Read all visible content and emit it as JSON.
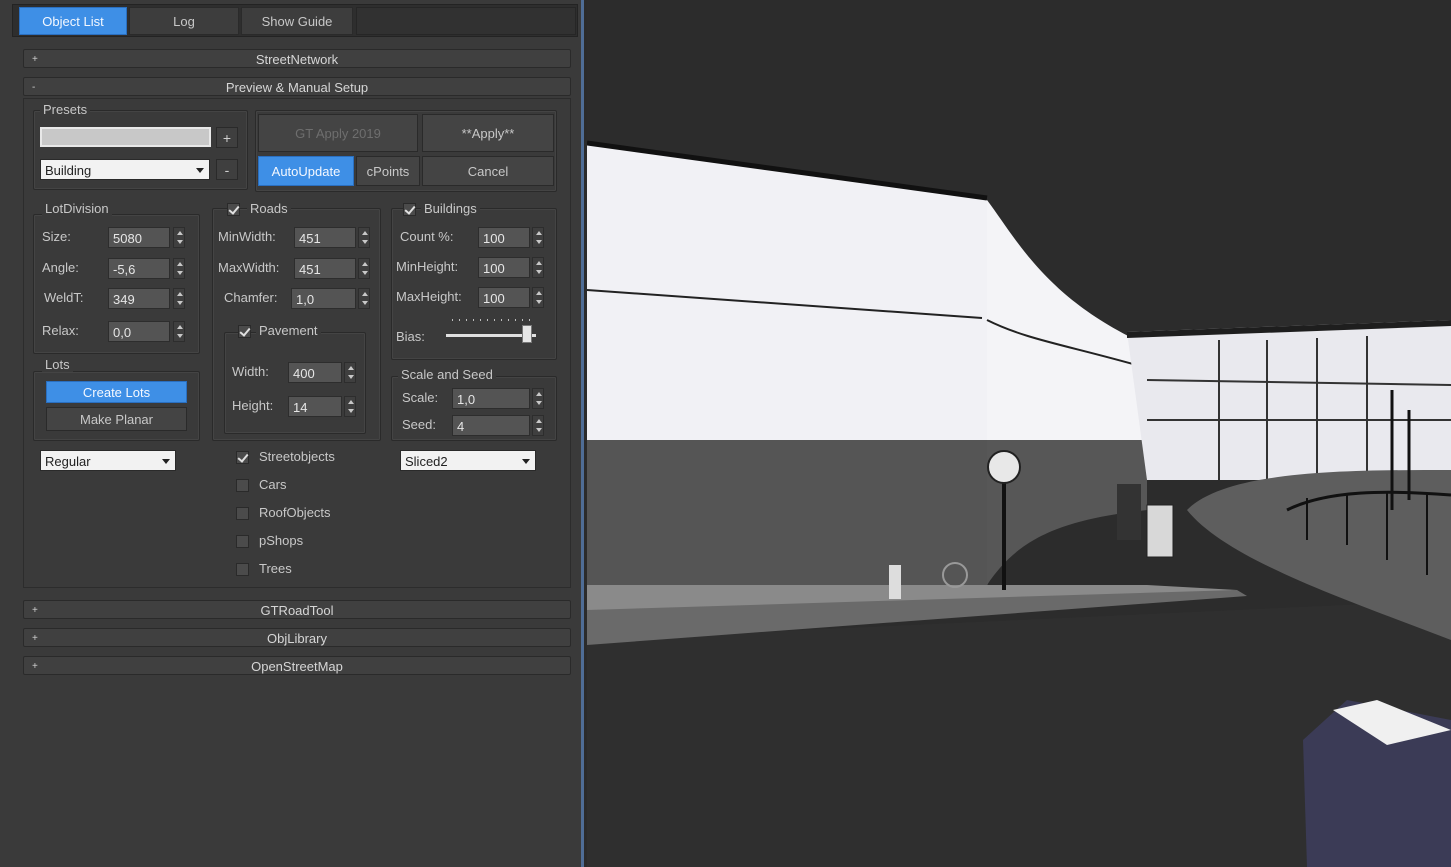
{
  "tabs": [
    {
      "label": "Object List",
      "active": true
    },
    {
      "label": "Log",
      "active": false
    },
    {
      "label": "Show Guide",
      "active": false
    }
  ],
  "rollouts": {
    "street_network": "StreetNetwork",
    "preview_setup": "Preview & Manual Setup",
    "gt_road_tool": "GTRoadTool",
    "obj_library": "ObjLibrary",
    "open_street_map": "OpenStreetMap",
    "collapsed_sign": "+",
    "expanded_sign": "-"
  },
  "presets": {
    "label": "Presets",
    "name_value": "",
    "add_label": "+",
    "remove_label": "-",
    "selected": "Building"
  },
  "actions": {
    "gt_apply_label": "GT Apply 2019",
    "apply_label": "**Apply**",
    "auto_update_label": "AutoUpdate",
    "cpoints_label": "cPoints",
    "cancel_label": "Cancel"
  },
  "lot_division": {
    "title": "LotDivision",
    "size_label": "Size:",
    "size_value": "5080",
    "angle_label": "Angle:",
    "angle_value": "-5,6",
    "weldt_label": "WeldT:",
    "weldt_value": "349",
    "relax_label": "Relax:",
    "relax_value": "0,0"
  },
  "lots": {
    "title": "Lots",
    "create_label": "Create Lots",
    "planar_label": "Make Planar",
    "mode_selected": "Regular"
  },
  "roads": {
    "title": "Roads",
    "checked": true,
    "minwidth_label": "MinWidth:",
    "minwidth_value": "451",
    "maxwidth_label": "MaxWidth:",
    "maxwidth_value": "451",
    "chamfer_label": "Chamfer:",
    "chamfer_value": "1,0"
  },
  "pavement": {
    "title": "Pavement",
    "checked": true,
    "width_label": "Width:",
    "width_value": "400",
    "height_label": "Height:",
    "height_value": "14"
  },
  "buildings": {
    "title": "Buildings",
    "checked": true,
    "count_label": "Count %:",
    "count_value": "100",
    "minheight_label": "MinHeight:",
    "minheight_value": "100",
    "maxheight_label": "MaxHeight:",
    "maxheight_value": "100",
    "bias_label": "Bias:",
    "bias_level": 0.95
  },
  "scale_seed": {
    "title": "Scale and Seed",
    "scale_label": "Scale:",
    "scale_value": "1,0",
    "seed_label": "Seed:",
    "seed_value": "4",
    "style_selected": "Sliced2"
  },
  "objects": [
    {
      "label": "Streetobjects",
      "checked": true
    },
    {
      "label": "Cars",
      "checked": false
    },
    {
      "label": "RoofObjects",
      "checked": false
    },
    {
      "label": "pShops",
      "checked": false
    },
    {
      "label": "Trees",
      "checked": false
    }
  ],
  "colors": {
    "accent": "#3e8fe6",
    "panel": "#3a3a3a",
    "viewport": "#2c2c2c",
    "wall": "#f2f2f6"
  }
}
